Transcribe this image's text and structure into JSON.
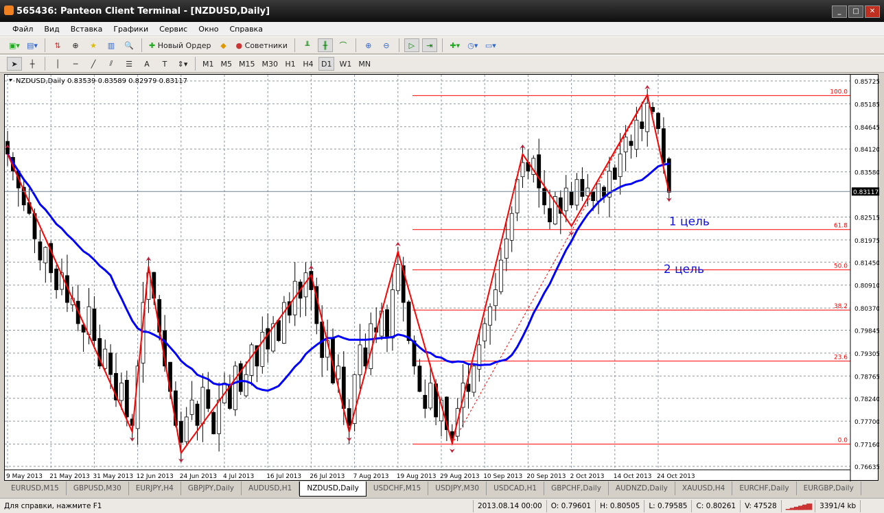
{
  "window": {
    "title": "565436: Panteon Client Terminal - [NZDUSD,Daily]"
  },
  "menu": [
    "Файл",
    "Вид",
    "Вставка",
    "Графики",
    "Сервис",
    "Окно",
    "Справка"
  ],
  "toolbar": {
    "new_order": "Новый Ордер",
    "advisors": "Советники"
  },
  "timeframes": [
    "M1",
    "M5",
    "M15",
    "M30",
    "H1",
    "H4",
    "D1",
    "W1",
    "MN"
  ],
  "active_timeframe": "D1",
  "chart_data": {
    "type": "candlestick",
    "title": "NZDUSD,Daily  0.83539 0.83589 0.82979 0.83117",
    "current_price": "0.83117",
    "ylim": [
      0.76635,
      0.85725
    ],
    "y_ticks": [
      "0.85725",
      "0.85185",
      "0.84645",
      "0.84120",
      "0.83580",
      "0.82515",
      "0.81975",
      "0.81450",
      "0.80910",
      "0.80370",
      "0.79845",
      "0.79305",
      "0.78765",
      "0.78240",
      "0.77700",
      "0.77160",
      "0.76635"
    ],
    "x_ticks": [
      {
        "i": 0,
        "label": "9 May 2013"
      },
      {
        "i": 8,
        "label": "21 May 2013"
      },
      {
        "i": 16,
        "label": "31 May 2013"
      },
      {
        "i": 24,
        "label": "12 Jun 2013"
      },
      {
        "i": 32,
        "label": "24 Jun 2013"
      },
      {
        "i": 40,
        "label": "4 Jul 2013"
      },
      {
        "i": 48,
        "label": "16 Jul 2013"
      },
      {
        "i": 56,
        "label": "26 Jul 2013"
      },
      {
        "i": 64,
        "label": "7 Aug 2013"
      },
      {
        "i": 72,
        "label": "19 Aug 2013"
      },
      {
        "i": 80,
        "label": "29 Aug 2013"
      },
      {
        "i": 88,
        "label": "10 Sep 2013"
      },
      {
        "i": 96,
        "label": "20 Sep 2013"
      },
      {
        "i": 104,
        "label": "2 Oct 2013"
      },
      {
        "i": 112,
        "label": "14 Oct 2013"
      },
      {
        "i": 120,
        "label": "24 Oct 2013"
      }
    ],
    "closes": [
      0.84,
      0.836,
      0.832,
      0.828,
      0.826,
      0.82,
      0.815,
      0.818,
      0.812,
      0.808,
      0.812,
      0.805,
      0.806,
      0.8,
      0.798,
      0.804,
      0.796,
      0.79,
      0.794,
      0.788,
      0.782,
      0.786,
      0.778,
      0.776,
      0.79,
      0.805,
      0.812,
      0.806,
      0.798,
      0.79,
      0.784,
      0.776,
      0.772,
      0.778,
      0.782,
      0.776,
      0.785,
      0.78,
      0.774,
      0.782,
      0.786,
      0.78,
      0.79,
      0.784,
      0.788,
      0.795,
      0.79,
      0.798,
      0.794,
      0.8,
      0.796,
      0.805,
      0.802,
      0.81,
      0.806,
      0.812,
      0.808,
      0.8,
      0.792,
      0.796,
      0.786,
      0.79,
      0.78,
      0.776,
      0.788,
      0.795,
      0.79,
      0.8,
      0.798,
      0.803,
      0.797,
      0.808,
      0.814,
      0.805,
      0.796,
      0.79,
      0.784,
      0.78,
      0.786,
      0.778,
      0.782,
      0.775,
      0.773,
      0.78,
      0.786,
      0.784,
      0.79,
      0.795,
      0.8,
      0.804,
      0.808,
      0.815,
      0.82,
      0.826,
      0.834,
      0.838,
      0.836,
      0.839,
      0.832,
      0.828,
      0.824,
      0.83,
      0.826,
      0.832,
      0.828,
      0.834,
      0.83,
      0.832,
      0.829,
      0.833,
      0.83,
      0.836,
      0.834,
      0.84,
      0.844,
      0.842,
      0.848,
      0.846,
      0.852,
      0.85,
      0.846,
      0.838,
      0.831
    ],
    "ma_period": 20,
    "zigzag": [
      [
        0,
        0.84
      ],
      [
        23,
        0.7745
      ],
      [
        26,
        0.8135
      ],
      [
        32,
        0.7695
      ],
      [
        56,
        0.8115
      ],
      [
        63,
        0.7745
      ],
      [
        72,
        0.817
      ],
      [
        82,
        0.7718
      ],
      [
        95,
        0.84
      ],
      [
        104,
        0.823
      ],
      [
        118,
        0.854
      ],
      [
        122,
        0.831
      ]
    ],
    "fib_levels": [
      {
        "label": "100.0",
        "price": 0.8538
      },
      {
        "label": "61.8",
        "price": 0.8222
      },
      {
        "label": "50.0",
        "price": 0.8127
      },
      {
        "label": "38.2",
        "price": 0.8032
      },
      {
        "label": "23.6",
        "price": 0.7912
      },
      {
        "label": "0.0",
        "price": 0.7716
      }
    ],
    "annotations": [
      {
        "text": "1 цель",
        "i": 122,
        "price": 0.8232
      },
      {
        "text": "2 цель",
        "i": 121,
        "price": 0.812
      }
    ],
    "colors": {
      "zigzag": "#ff0000",
      "ma": "#0000ff",
      "fib": "#ff0000"
    }
  },
  "tabs": [
    "EURUSD,M15",
    "GBPUSD,M30",
    "EURJPY,H4",
    "GBPJPY,Daily",
    "AUDUSD,H1",
    "NZDUSD,Daily",
    "USDCHF,M15",
    "USDJPY,M30",
    "USDCAD,H1",
    "GBPCHF,Daily",
    "AUDNZD,Daily",
    "XAUUSD,H4",
    "EURCHF,Daily",
    "EURGBP,Daily"
  ],
  "active_tab": "NZDUSD,Daily",
  "status": {
    "help": "Для справки, нажмите F1",
    "datetime": "2013.08.14 00:00",
    "open": "O: 0.79601",
    "high": "H: 0.80505",
    "low": "L: 0.79585",
    "close": "C: 0.80261",
    "volume": "V: 47528",
    "traffic": "3391/4 kb"
  }
}
